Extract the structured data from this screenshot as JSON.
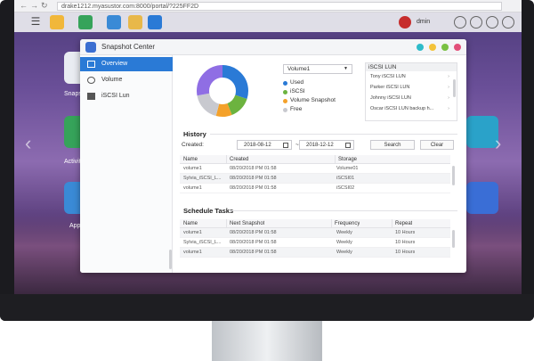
{
  "browser": {
    "url": "drake1212.myasustor.com:8000/portal/?225FF2D"
  },
  "taskbar": {
    "user": "dmin"
  },
  "desktop": {
    "labels": [
      "Snapsh",
      "Activity",
      "App"
    ]
  },
  "window": {
    "title": "Snapshot Center",
    "sidebar": [
      {
        "label": "Overview"
      },
      {
        "label": "Volume"
      },
      {
        "label": "iSCSI Lun"
      }
    ]
  },
  "overview": {
    "volume_select": "Volume1",
    "legend": [
      {
        "label": "Used",
        "color": "#2a7ad6"
      },
      {
        "label": "iSCSI",
        "color": "#6cb33f"
      },
      {
        "label": "Volume Snapshot",
        "color": "#f4a12a"
      },
      {
        "label": "Free",
        "color": "#c8c9cf"
      }
    ],
    "pie_values": [
      {
        "name": "Used",
        "value": 30,
        "color": "#2a7ad6"
      },
      {
        "name": "iSCSI",
        "value": 14,
        "color": "#6cb33f"
      },
      {
        "name": "Volume Snapshot",
        "value": 10,
        "color": "#f4a12a"
      },
      {
        "name": "Free",
        "value": 18,
        "color": "#c8c9cf"
      },
      {
        "name": "",
        "value": 28,
        "color": "#8f6ee4"
      }
    ],
    "iscsi": {
      "header": "iSCSI LUN",
      "items": [
        "Tony iSCSI LUN",
        "Parker iSCSI LUN",
        "Johnny iSCSI LUN",
        "Oscar iSCSI LUN backup h..."
      ]
    }
  },
  "history": {
    "title": "History",
    "created_label": "Created:",
    "from_date": "2018-08-12",
    "to_sep": "~",
    "to_date": "2018-12-12",
    "search_label": "Search",
    "clear_label": "Clear",
    "columns": [
      "Name",
      "Created",
      "Storage"
    ],
    "rows": [
      [
        "volume1",
        "08/20/2018 PM 01:58",
        "Volume01"
      ],
      [
        "Sylvia_iSCSI_L...",
        "08/20/2018 PM 01:58",
        "iSCSI01"
      ],
      [
        "volume1",
        "08/20/2018 PM 01:58",
        "iSCSI02"
      ]
    ]
  },
  "schedule": {
    "title": "Schedule Tasks",
    "columns": [
      "Name",
      "Next Snapshot",
      "Frequency",
      "Repeat"
    ],
    "rows": [
      [
        "volume1",
        "08/20/2018 PM 01:58",
        "Weekly",
        "10 Hours"
      ],
      [
        "Sylvia_iSCSI_L...",
        "08/20/2018 PM 01:58",
        "Weekly",
        "10 Hours"
      ],
      [
        "volume1",
        "08/20/2018 PM 01:58",
        "Weekly",
        "10 Hours"
      ]
    ]
  }
}
